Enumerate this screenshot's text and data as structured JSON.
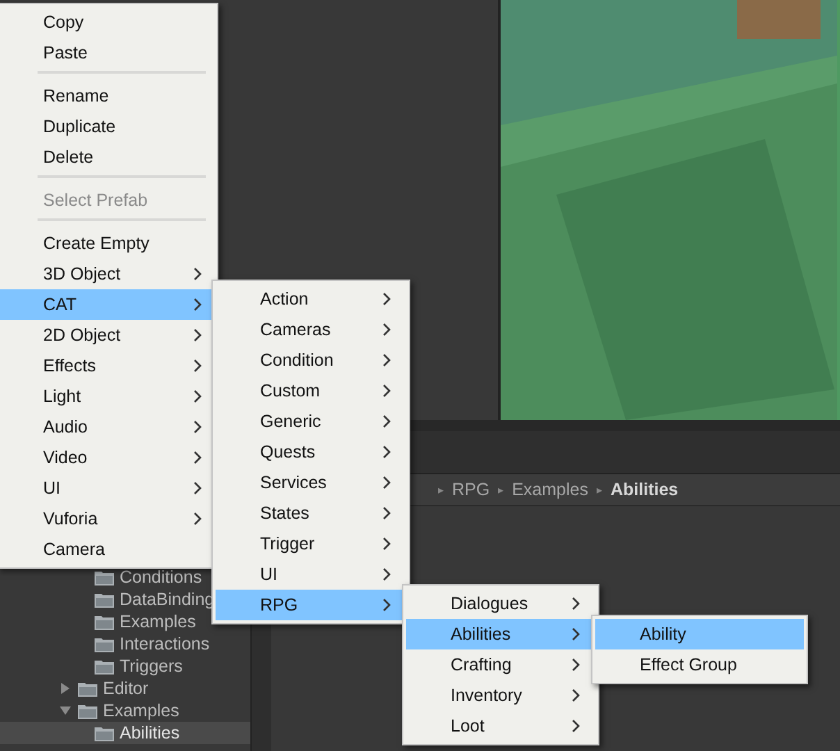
{
  "context_menu": [
    {
      "kind": "item",
      "label": "Copy",
      "disabled": false,
      "selected": false,
      "has_submenu": false
    },
    {
      "kind": "item",
      "label": "Paste",
      "disabled": false,
      "selected": false,
      "has_submenu": false
    },
    {
      "kind": "separator"
    },
    {
      "kind": "item",
      "label": "Rename",
      "disabled": false,
      "selected": false,
      "has_submenu": false
    },
    {
      "kind": "item",
      "label": "Duplicate",
      "disabled": false,
      "selected": false,
      "has_submenu": false
    },
    {
      "kind": "item",
      "label": "Delete",
      "disabled": false,
      "selected": false,
      "has_submenu": false
    },
    {
      "kind": "separator"
    },
    {
      "kind": "item",
      "label": "Select Prefab",
      "disabled": true,
      "selected": false,
      "has_submenu": false
    },
    {
      "kind": "separator"
    },
    {
      "kind": "item",
      "label": "Create Empty",
      "disabled": false,
      "selected": false,
      "has_submenu": false
    },
    {
      "kind": "item",
      "label": "3D Object",
      "disabled": false,
      "selected": false,
      "has_submenu": true
    },
    {
      "kind": "item",
      "label": "CAT",
      "disabled": false,
      "selected": true,
      "has_submenu": true
    },
    {
      "kind": "item",
      "label": "2D Object",
      "disabled": false,
      "selected": false,
      "has_submenu": true
    },
    {
      "kind": "item",
      "label": "Effects",
      "disabled": false,
      "selected": false,
      "has_submenu": true
    },
    {
      "kind": "item",
      "label": "Light",
      "disabled": false,
      "selected": false,
      "has_submenu": true
    },
    {
      "kind": "item",
      "label": "Audio",
      "disabled": false,
      "selected": false,
      "has_submenu": true
    },
    {
      "kind": "item",
      "label": "Video",
      "disabled": false,
      "selected": false,
      "has_submenu": true
    },
    {
      "kind": "item",
      "label": "UI",
      "disabled": false,
      "selected": false,
      "has_submenu": true
    },
    {
      "kind": "item",
      "label": "Vuforia",
      "disabled": false,
      "selected": false,
      "has_submenu": true
    },
    {
      "kind": "item",
      "label": "Camera",
      "disabled": false,
      "selected": false,
      "has_submenu": false
    }
  ],
  "cat_submenu": [
    {
      "kind": "item",
      "label": "Action",
      "disabled": false,
      "selected": false,
      "has_submenu": true
    },
    {
      "kind": "item",
      "label": "Cameras",
      "disabled": false,
      "selected": false,
      "has_submenu": true
    },
    {
      "kind": "item",
      "label": "Condition",
      "disabled": false,
      "selected": false,
      "has_submenu": true
    },
    {
      "kind": "item",
      "label": "Custom",
      "disabled": false,
      "selected": false,
      "has_submenu": true
    },
    {
      "kind": "item",
      "label": "Generic",
      "disabled": false,
      "selected": false,
      "has_submenu": true
    },
    {
      "kind": "item",
      "label": "Quests",
      "disabled": false,
      "selected": false,
      "has_submenu": true
    },
    {
      "kind": "item",
      "label": "Services",
      "disabled": false,
      "selected": false,
      "has_submenu": true
    },
    {
      "kind": "item",
      "label": "States",
      "disabled": false,
      "selected": false,
      "has_submenu": true
    },
    {
      "kind": "item",
      "label": "Trigger",
      "disabled": false,
      "selected": false,
      "has_submenu": true
    },
    {
      "kind": "item",
      "label": "UI",
      "disabled": false,
      "selected": false,
      "has_submenu": true
    },
    {
      "kind": "item",
      "label": "RPG",
      "disabled": false,
      "selected": true,
      "has_submenu": true
    }
  ],
  "rpg_submenu": [
    {
      "kind": "item",
      "label": "Dialogues",
      "disabled": false,
      "selected": false,
      "has_submenu": true
    },
    {
      "kind": "item",
      "label": "Abilities",
      "disabled": false,
      "selected": true,
      "has_submenu": true
    },
    {
      "kind": "item",
      "label": "Crafting",
      "disabled": false,
      "selected": false,
      "has_submenu": true
    },
    {
      "kind": "item",
      "label": "Inventory",
      "disabled": false,
      "selected": false,
      "has_submenu": true
    },
    {
      "kind": "item",
      "label": "Loot",
      "disabled": false,
      "selected": false,
      "has_submenu": true
    }
  ],
  "abilities_submenu": [
    {
      "kind": "item",
      "label": "Ability",
      "disabled": false,
      "selected": true,
      "has_submenu": false
    },
    {
      "kind": "item",
      "label": "Effect Group",
      "disabled": false,
      "selected": false,
      "has_submenu": false
    }
  ],
  "breadcrumb": [
    {
      "separator": "▸",
      "label": "RPG"
    },
    {
      "separator": "▸",
      "label": "Examples"
    },
    {
      "separator": "▸",
      "label": "Abilities"
    }
  ],
  "project_tree": {
    "rows_above": [
      {
        "label": "Conditions",
        "selected": false
      },
      {
        "label": "DataBinding",
        "selected": false
      },
      {
        "label": "Examples",
        "selected": false
      },
      {
        "label": "Interactions",
        "selected": false
      },
      {
        "label": "Triggers",
        "selected": false
      }
    ],
    "items": [
      {
        "label": "Editor",
        "expanded": false,
        "selected": false
      },
      {
        "label": "Examples",
        "expanded": true,
        "selected": false,
        "children": [
          {
            "label": "Abilities",
            "selected": true
          }
        ]
      }
    ]
  }
}
